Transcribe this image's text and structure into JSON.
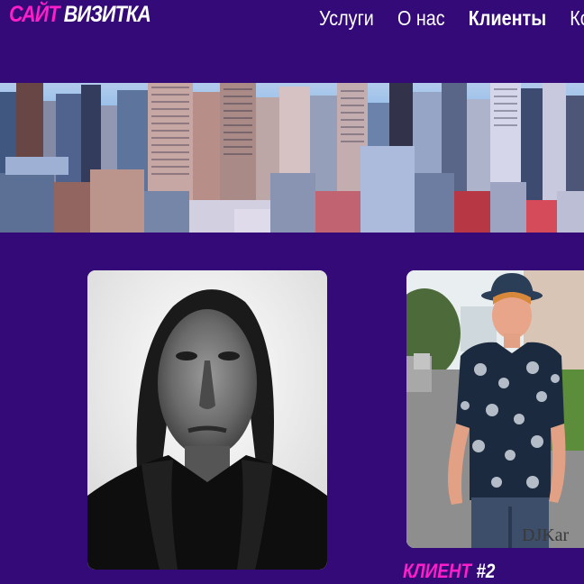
{
  "site": {
    "logo_part1": "САЙТ",
    "logo_part2": "ВИЗИТКА"
  },
  "nav": {
    "items": [
      {
        "label": "Услуги"
      },
      {
        "label": "О нас"
      },
      {
        "label": "Клиенты"
      },
      {
        "label": "Кон"
      }
    ],
    "active": "Клиенты"
  },
  "clients": [
    {
      "caption_prefix": "",
      "caption_number": ""
    },
    {
      "caption_prefix": "КЛИЕНТ",
      "caption_number": "#2",
      "photo_watermark": "DJKar"
    }
  ],
  "colors": {
    "background": "#330a77",
    "accent_pink": "#ff1ec8",
    "text": "#ffffff"
  }
}
